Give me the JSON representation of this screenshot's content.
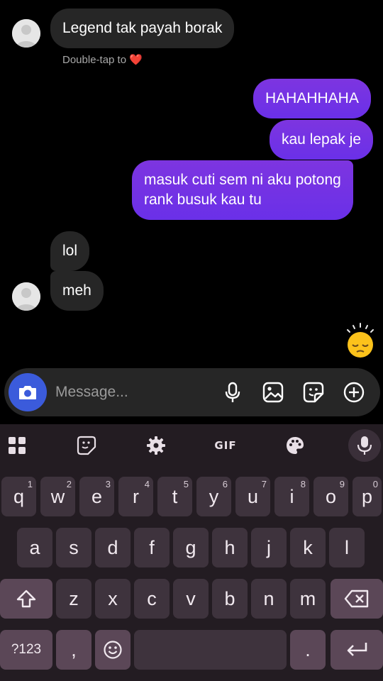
{
  "messages": [
    {
      "text": "Legend tak payah borak",
      "side": "in"
    },
    {
      "text": "HAHAHHAHA",
      "side": "out"
    },
    {
      "text": "kau lepak je",
      "side": "out"
    },
    {
      "text": "masuk cuti sem ni aku potong",
      "side": "out"
    },
    {
      "text": "rank busuk kau tu",
      "side": "out"
    },
    {
      "text": "lol",
      "side": "in"
    },
    {
      "text": "meh",
      "side": "in"
    }
  ],
  "hint": {
    "text": "Double-tap to",
    "heart": "❤️"
  },
  "reaction_emoji": "sleepy-sun-emoji",
  "composer": {
    "placeholder": "Message...",
    "icons": [
      "camera-icon",
      "microphone-icon",
      "image-icon",
      "sticker-icon",
      "plus-circle-icon"
    ],
    "accent": "#3b5bdb"
  },
  "keyboard": {
    "toolbar": {
      "gif": "GIF",
      "icons": [
        "apps-grid-icon",
        "sticker-icon",
        "settings-icon",
        "gif-icon",
        "palette-icon",
        "mic-icon"
      ]
    },
    "row1": [
      {
        "k": "q",
        "n": "1"
      },
      {
        "k": "w",
        "n": "2"
      },
      {
        "k": "e",
        "n": "3"
      },
      {
        "k": "r",
        "n": "4"
      },
      {
        "k": "t",
        "n": "5"
      },
      {
        "k": "y",
        "n": "6"
      },
      {
        "k": "u",
        "n": "7"
      },
      {
        "k": "i",
        "n": "8"
      },
      {
        "k": "o",
        "n": "9"
      },
      {
        "k": "p",
        "n": "0"
      }
    ],
    "row2": [
      "a",
      "s",
      "d",
      "f",
      "g",
      "h",
      "j",
      "k",
      "l"
    ],
    "row3": [
      "z",
      "x",
      "c",
      "v",
      "b",
      "n",
      "m"
    ],
    "symbols": "?123",
    "comma": ",",
    "period": "."
  },
  "colors": {
    "outgoing": "#7d35e0",
    "incoming": "#262626",
    "keyboard_bg": "#231c22"
  }
}
